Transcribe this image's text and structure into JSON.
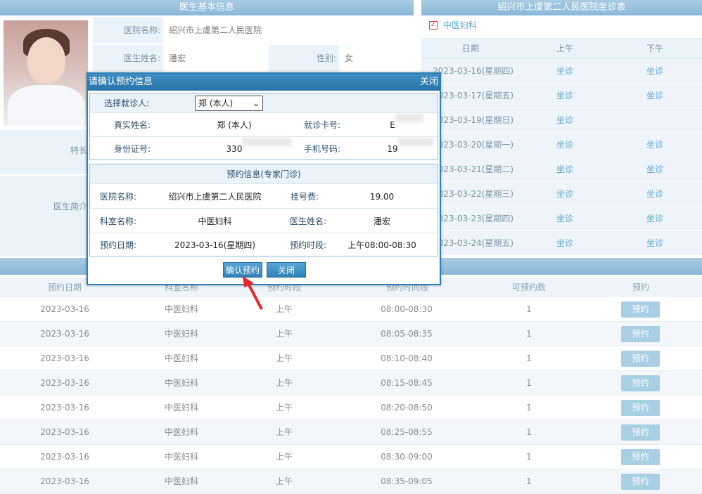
{
  "doctor_panel": {
    "title": "医生基本信息",
    "hospital_label": "医院名称:",
    "hospital_value": "绍兴市上虞第二人民医院",
    "name_label": "医生姓名:",
    "name_value": "潘宏",
    "gender_label": "性别:",
    "gender_value": "女",
    "specialty_label": "特长",
    "intro_label": "医生简介"
  },
  "schedule_panel": {
    "title": "绍兴市上虞第二人民医院坐诊表",
    "department": "中医妇科",
    "headers": [
      "日期",
      "上午",
      "下午"
    ],
    "rows": [
      {
        "date": "2023-03-16(星期四)",
        "am": "坐诊",
        "pm": "坐诊"
      },
      {
        "date": "2023-03-17(星期五)",
        "am": "坐诊",
        "pm": "坐诊"
      },
      {
        "date": "2023-03-19(星期日)",
        "am": "坐诊",
        "pm": ""
      },
      {
        "date": "2023-03-20(星期一)",
        "am": "坐诊",
        "pm": "坐诊"
      },
      {
        "date": "2023-03-21(星期二)",
        "am": "坐诊",
        "pm": "坐诊"
      },
      {
        "date": "2023-03-22(星期三)",
        "am": "坐诊",
        "pm": "坐诊"
      },
      {
        "date": "2023-03-23(星期四)",
        "am": "坐诊",
        "pm": "坐诊"
      },
      {
        "date": "2023-03-24(星期五)",
        "am": "坐诊",
        "pm": "坐诊"
      }
    ]
  },
  "slot_table": {
    "headers": [
      "预约日期",
      "科室名称",
      "预约时段",
      "预约时间段",
      "可预约数",
      "预约"
    ],
    "rows": [
      {
        "date": "2023-03-16",
        "dept": "中医妇科",
        "period": "上午",
        "time": "08:00-08:30",
        "count": "1",
        "action": "预约"
      },
      {
        "date": "2023-03-16",
        "dept": "中医妇科",
        "period": "上午",
        "time": "08:05-08:35",
        "count": "1",
        "action": "预约"
      },
      {
        "date": "2023-03-16",
        "dept": "中医妇科",
        "period": "上午",
        "time": "08:10-08:40",
        "count": "1",
        "action": "预约"
      },
      {
        "date": "2023-03-16",
        "dept": "中医妇科",
        "period": "上午",
        "time": "08:15-08:45",
        "count": "1",
        "action": "预约"
      },
      {
        "date": "2023-03-16",
        "dept": "中医妇科",
        "period": "上午",
        "time": "08:20-08:50",
        "count": "1",
        "action": "预约"
      },
      {
        "date": "2023-03-16",
        "dept": "中医妇科",
        "period": "上午",
        "time": "08:25-08:55",
        "count": "1",
        "action": "预约"
      },
      {
        "date": "2023-03-16",
        "dept": "中医妇科",
        "period": "上午",
        "time": "08:30-09:00",
        "count": "1",
        "action": "预约"
      },
      {
        "date": "2023-03-16",
        "dept": "中医妇科",
        "period": "上午",
        "time": "08:35-09:05",
        "count": "1",
        "action": "预约"
      }
    ]
  },
  "modal": {
    "title": "请确认预约信息",
    "close_link": "关闭",
    "patient_select_label": "选择就诊人:",
    "patient_select_value": "郑 (本人)",
    "real_name_label": "真实姓名:",
    "real_name_value": "郑 (本人)",
    "card_label": "就诊卡号:",
    "card_value": "E",
    "id_label": "身份证号:",
    "id_value": "330",
    "phone_label": "手机号码:",
    "phone_value": "19",
    "section_title": "预约信息(专家门诊)",
    "hospital_label": "医院名称:",
    "hospital_value": "绍兴市上虞第二人民医院",
    "fee_label": "挂号费:",
    "fee_value": "19.00",
    "dept_label": "科室名称:",
    "dept_value": "中医妇科",
    "doctor_label": "医生姓名:",
    "doctor_value": "潘宏",
    "date_label": "预约日期:",
    "date_value": "2023-03-16(星期四)",
    "period_label": "预约时段:",
    "period_value": "上午08:00-08:30",
    "confirm_button": "确认预约",
    "close_button": "关闭"
  },
  "colors": {
    "header_blue": "#8ab8d8",
    "modal_border": "#2d7fb5",
    "link_blue": "#5ba5cf",
    "button_light": "#a8cfe4",
    "annotation_arrow": "#e8262a"
  }
}
